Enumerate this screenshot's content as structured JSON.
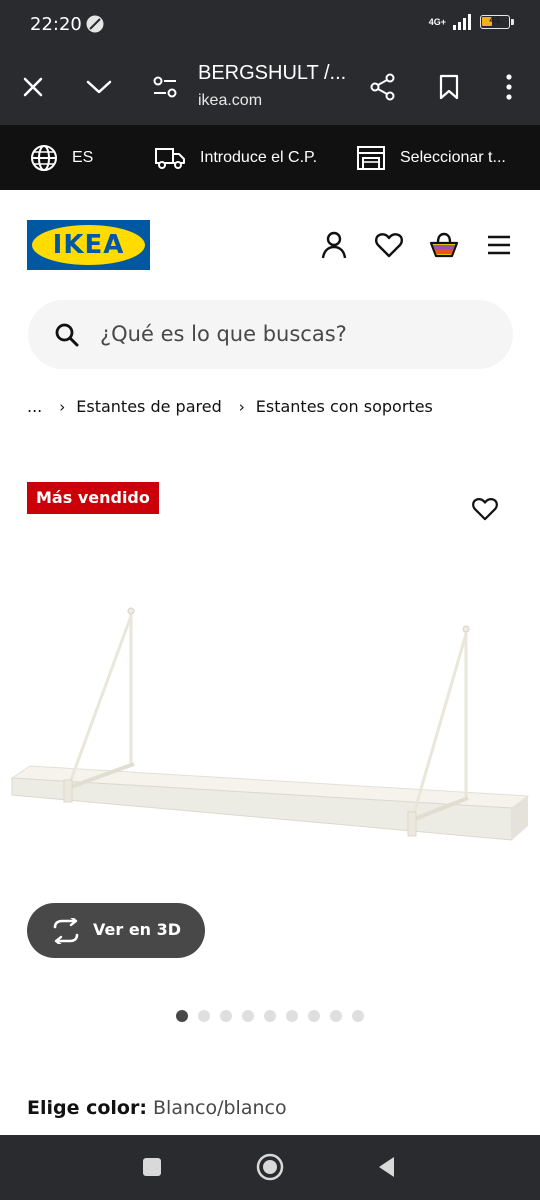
{
  "status_bar": {
    "time": "22:20",
    "network": "4G+",
    "battery_level": "41",
    "icons": [
      "do-not-disturb-icon",
      "signal-icon",
      "battery-icon"
    ]
  },
  "browser": {
    "page_title": "BERGSHULT /...",
    "domain": "ikea.com",
    "icons": [
      "close-icon",
      "chevron-down-icon",
      "page-settings-icon",
      "share-icon",
      "bookmark-icon",
      "more-options-icon"
    ]
  },
  "top_strip": {
    "language": "ES",
    "postal_code": "Introduce el C.P.",
    "store": "Seleccionar t...",
    "icons": [
      "globe-icon",
      "delivery-truck-icon",
      "store-icon"
    ]
  },
  "header": {
    "logo_text": "IKEA",
    "icons": [
      "account-icon",
      "heart-icon",
      "shopping-bag-icon",
      "menu-icon"
    ]
  },
  "search": {
    "placeholder": "¿Qué es lo que buscas?"
  },
  "breadcrumb": {
    "ellipsis": "...",
    "items": [
      "Estantes de pared",
      "Estantes con soportes"
    ]
  },
  "product": {
    "badge": "Más vendido",
    "view_3d_label": "Ver en 3D",
    "image_count": 9,
    "active_image": 1,
    "color_label": "Elige color:",
    "color_value": "Blanco/blanco"
  },
  "colors": {
    "ikea_blue": "#0058a3",
    "ikea_yellow": "#ffdb00",
    "badge_red": "#cc0008",
    "dark_chrome": "#2a2b2e",
    "strip_black": "#111111"
  },
  "nav_bar": {
    "icons": [
      "recent-apps-icon",
      "home-icon",
      "back-icon"
    ]
  }
}
